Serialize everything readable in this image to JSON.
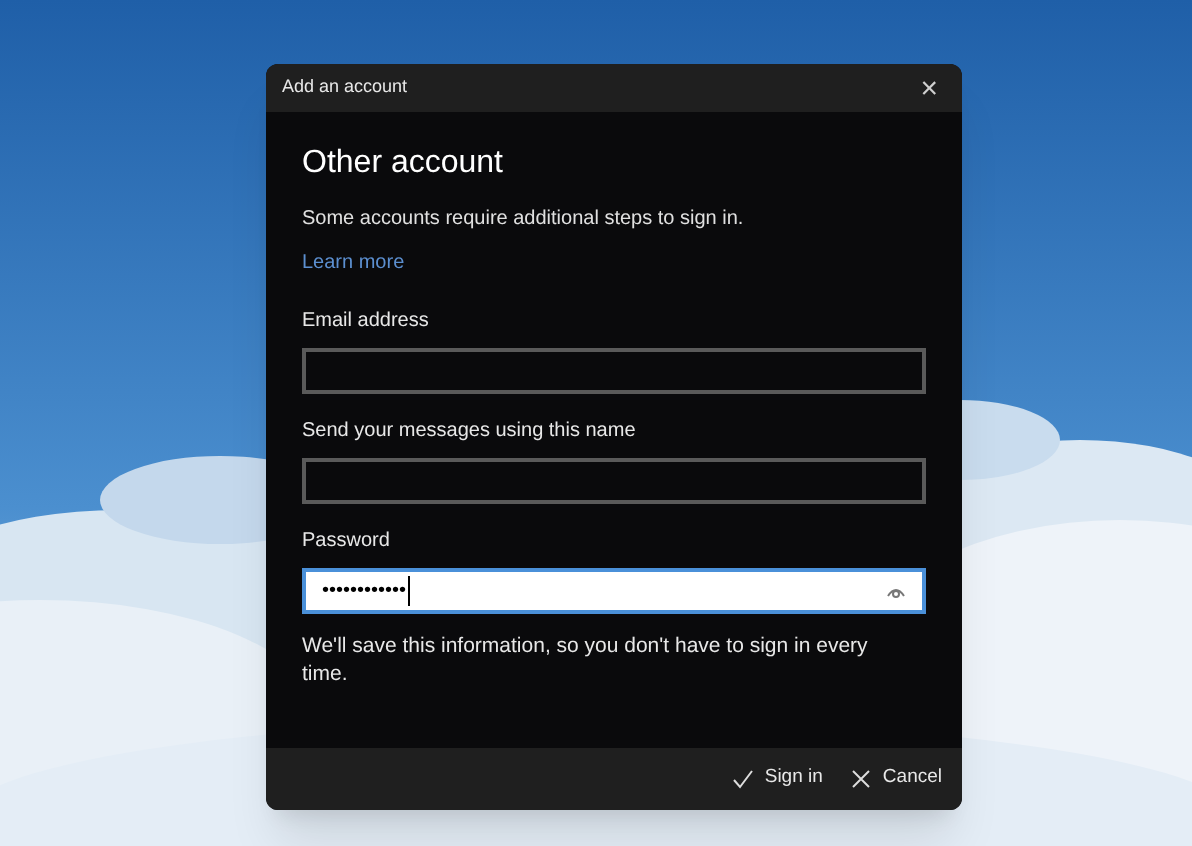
{
  "window": {
    "title": "Add an account",
    "close": "×"
  },
  "heading": "Other account",
  "description": "Some accounts require additional steps to sign in.",
  "link": "Learn more",
  "fields": [
    {
      "label": "Email address",
      "kind": "text",
      "focused": false
    },
    {
      "label": "Send your messages using this name",
      "kind": "text",
      "focused": false
    },
    {
      "label": "Password",
      "kind": "password",
      "value": "••••••••••••",
      "focused": true
    }
  ],
  "note": "We'll save this information, so you don't have to sign in every time.",
  "buttons": [
    {
      "label": "Sign in",
      "kind": "confirm"
    },
    {
      "label": "Cancel",
      "kind": "cancel"
    }
  ]
}
